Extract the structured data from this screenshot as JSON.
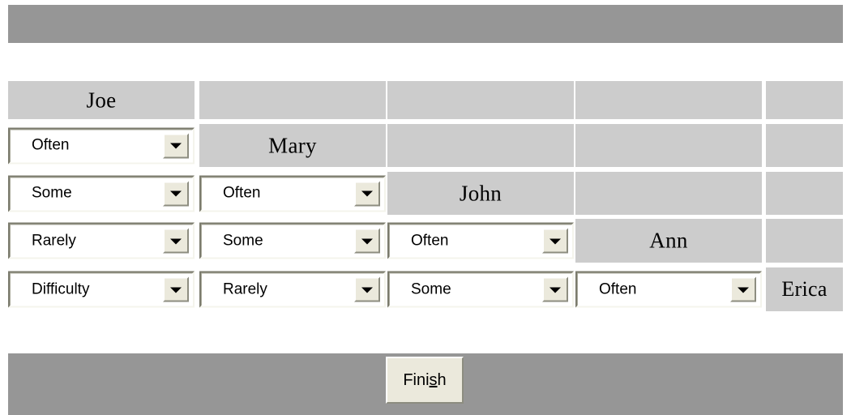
{
  "window": {
    "top_bar_color": "#969696",
    "bottom_bar_color": "#969696",
    "cell_color": "#cccccc",
    "combo_face_color": "#ffffff",
    "button_face_color": "#ebe9dc"
  },
  "matrix": {
    "people": [
      "Joe",
      "Mary",
      "John",
      "Ann",
      "Erica"
    ],
    "frequency_options": [
      "Often",
      "Some",
      "Rarely",
      "Difficulty"
    ],
    "rows": [
      {
        "label_column": 0,
        "label": "Joe",
        "cells": [
          {
            "type": "label",
            "text": "Joe"
          },
          {
            "type": "empty",
            "text": ""
          },
          {
            "type": "empty",
            "text": ""
          },
          {
            "type": "empty",
            "text": ""
          },
          {
            "type": "empty",
            "text": ""
          }
        ]
      },
      {
        "label_column": 1,
        "label": "Mary",
        "cells": [
          {
            "type": "combo",
            "text": "Often"
          },
          {
            "type": "label",
            "text": "Mary"
          },
          {
            "type": "empty",
            "text": ""
          },
          {
            "type": "empty",
            "text": ""
          },
          {
            "type": "empty",
            "text": ""
          }
        ]
      },
      {
        "label_column": 2,
        "label": "John",
        "cells": [
          {
            "type": "combo",
            "text": "Some"
          },
          {
            "type": "combo",
            "text": "Often"
          },
          {
            "type": "label",
            "text": "John"
          },
          {
            "type": "empty",
            "text": ""
          },
          {
            "type": "empty",
            "text": ""
          }
        ]
      },
      {
        "label_column": 3,
        "label": "Ann",
        "cells": [
          {
            "type": "combo",
            "text": "Rarely"
          },
          {
            "type": "combo",
            "text": "Some"
          },
          {
            "type": "combo",
            "text": "Often"
          },
          {
            "type": "label",
            "text": "Ann"
          },
          {
            "type": "empty",
            "text": ""
          }
        ]
      },
      {
        "label_column": 4,
        "label": "Erica",
        "cells": [
          {
            "type": "combo",
            "text": "Difficulty"
          },
          {
            "type": "combo",
            "text": "Rarely"
          },
          {
            "type": "combo",
            "text": "Some"
          },
          {
            "type": "combo",
            "text": "Often"
          },
          {
            "type": "label",
            "text": "Erica"
          }
        ]
      }
    ]
  },
  "footer": {
    "finish_button": {
      "prefix": "Fini",
      "accel": "s",
      "suffix": "h",
      "full_label": "Finish"
    }
  }
}
